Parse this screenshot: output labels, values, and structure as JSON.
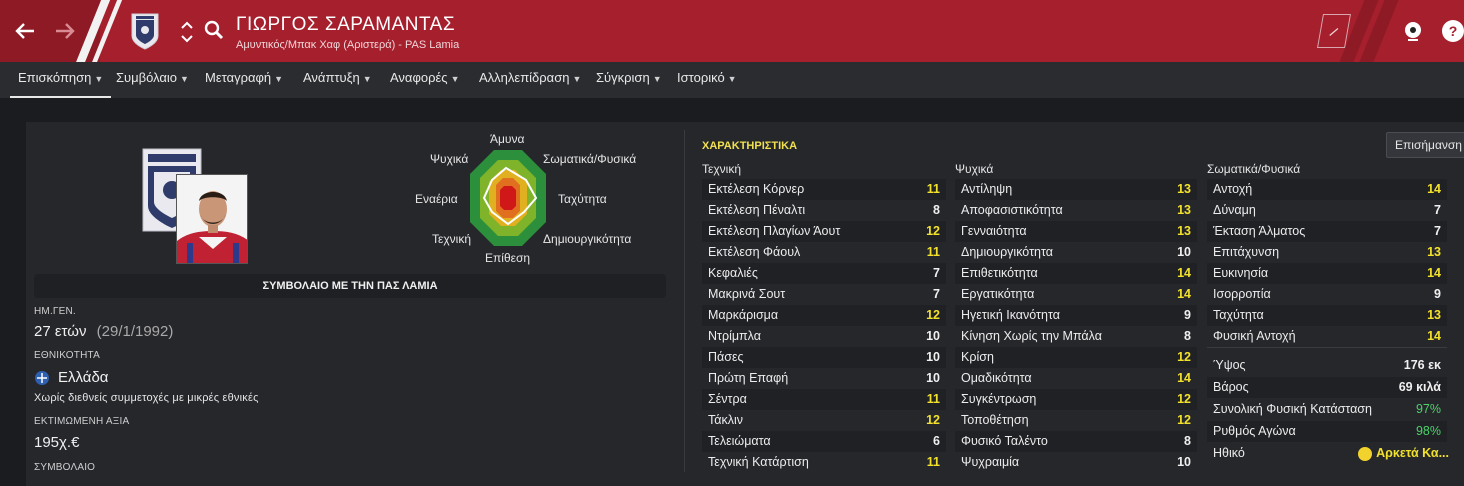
{
  "header": {
    "name": "ΓΙΩΡΓΟΣ ΣΑΡΑΜΑΝΤΑΣ",
    "subtitle": "Αμυντικός/Μπακ Χαφ (Αριστερά) - PAS Lamia",
    "colors": {
      "primary": "#a51f2d",
      "dark": "#8e1a25",
      "accent": "#f2e12c"
    }
  },
  "tabs": [
    {
      "label": "Επισκόπηση"
    },
    {
      "label": "Συμβόλαιο"
    },
    {
      "label": "Μεταγραφή"
    },
    {
      "label": "Ανάπτυξη"
    },
    {
      "label": "Αναφορές"
    },
    {
      "label": "Αλληλεπίδραση"
    },
    {
      "label": "Σύγκριση"
    },
    {
      "label": "Ιστορικό"
    }
  ],
  "radar": {
    "labels": {
      "top": "Άμυνα",
      "top_left": "Ψυχικά",
      "top_right": "Σωματικά/Φυσικά",
      "left": "Εναέρια",
      "right": "Ταχύτητα",
      "bottom_left": "Τεχνική",
      "bottom_right": "Δημιουργικότητα",
      "bottom": "Επίθεση"
    }
  },
  "contract_bar": "ΣΥΜΒΟΛΑΙΟ ΜΕ ΤΗΝ ΠΑΣ ΛΑΜΙΑ",
  "info": {
    "dob_label": "ΗΜ.ΓΕΝ.",
    "age": "27 ετών",
    "dob": "(29/1/1992)",
    "nationality_label": "ΕΘΝΙΚΟΤΗΤΑ",
    "nationality": "Ελλάδα",
    "intl_note": "Χωρίς διεθνείς συμμετοχές με μικρές εθνικές",
    "value_label": "ΕΚΤΙΜΩΜΕΝΗ ΑΞΙΑ",
    "value": "195χ.€",
    "contract_label": "ΣΥΜΒΟΛΑΙΟ"
  },
  "attributes": {
    "title": "ΧΑΡΑΚΤΗΡΙΣΤΙΚΑ",
    "highlight_button": "Επισήμανση",
    "technical": {
      "header": "Τεχνική",
      "items": [
        {
          "name": "Εκτέλεση Κόρνερ",
          "value": "11"
        },
        {
          "name": "Εκτέλεση Πέναλτι",
          "value": "8"
        },
        {
          "name": "Εκτέλεση Πλαγίων Άουτ",
          "value": "12"
        },
        {
          "name": "Εκτέλεση Φάουλ",
          "value": "11"
        },
        {
          "name": "Κεφαλιές",
          "value": "7"
        },
        {
          "name": "Μακρινά Σουτ",
          "value": "7"
        },
        {
          "name": "Μαρκάρισμα",
          "value": "12"
        },
        {
          "name": "Ντρίμπλα",
          "value": "10"
        },
        {
          "name": "Πάσες",
          "value": "10"
        },
        {
          "name": "Πρώτη Επαφή",
          "value": "10"
        },
        {
          "name": "Σέντρα",
          "value": "11"
        },
        {
          "name": "Τάκλιν",
          "value": "12"
        },
        {
          "name": "Τελειώματα",
          "value": "6"
        },
        {
          "name": "Τεχνική Κατάρτιση",
          "value": "11"
        }
      ]
    },
    "mental": {
      "header": "Ψυχικά",
      "items": [
        {
          "name": "Αντίληψη",
          "value": "13"
        },
        {
          "name": "Αποφασιστικότητα",
          "value": "13"
        },
        {
          "name": "Γενναιότητα",
          "value": "13"
        },
        {
          "name": "Δημιουργικότητα",
          "value": "10"
        },
        {
          "name": "Επιθετικότητα",
          "value": "14"
        },
        {
          "name": "Εργατικότητα",
          "value": "14"
        },
        {
          "name": "Ηγετική Ικανότητα",
          "value": "9"
        },
        {
          "name": "Κίνηση Χωρίς την Μπάλα",
          "value": "8"
        },
        {
          "name": "Κρίση",
          "value": "12"
        },
        {
          "name": "Ομαδικότητα",
          "value": "14"
        },
        {
          "name": "Συγκέντρωση",
          "value": "12"
        },
        {
          "name": "Τοποθέτηση",
          "value": "12"
        },
        {
          "name": "Φυσικό Ταλέντο",
          "value": "8"
        },
        {
          "name": "Ψυχραιμία",
          "value": "10"
        }
      ]
    },
    "physical": {
      "header": "Σωματικά/Φυσικά",
      "items": [
        {
          "name": "Αντοχή",
          "value": "14"
        },
        {
          "name": "Δύναμη",
          "value": "7"
        },
        {
          "name": "Έκταση Άλματος",
          "value": "7"
        },
        {
          "name": "Επιτάχυνση",
          "value": "13"
        },
        {
          "name": "Ευκινησία",
          "value": "14"
        },
        {
          "name": "Ισορροπία",
          "value": "9"
        },
        {
          "name": "Ταχύτητα",
          "value": "13"
        },
        {
          "name": "Φυσική Αντοχή",
          "value": "14"
        }
      ]
    },
    "extra": [
      {
        "name": "Ύψος",
        "value": "176 εκ"
      },
      {
        "name": "Βάρος",
        "value": "69 κιλά"
      },
      {
        "name": "Συνολική Φυσική Κατάσταση",
        "value": "97%"
      },
      {
        "name": "Ρυθμός Αγώνα",
        "value": "98%"
      },
      {
        "name": "Ηθικό",
        "value": "Αρκετά Κα..."
      }
    ]
  }
}
